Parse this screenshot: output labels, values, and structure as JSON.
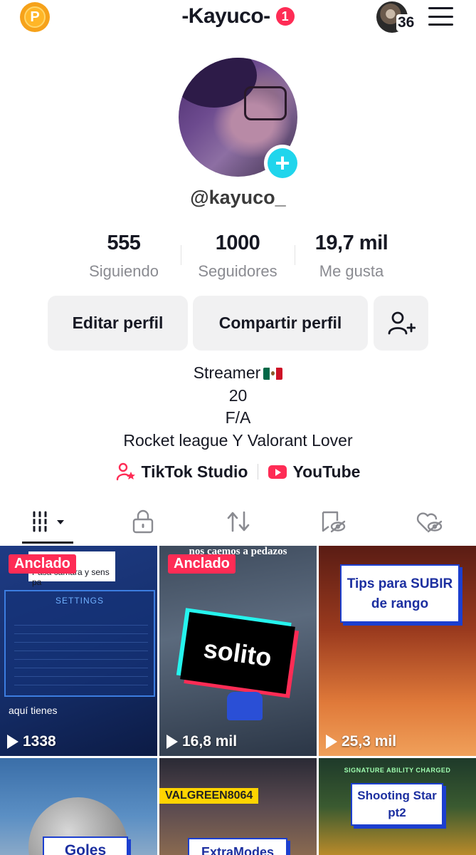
{
  "header": {
    "coin_glyph": "P",
    "title": "-Kayuco-",
    "notification_count": "1",
    "account_count": "36"
  },
  "profile": {
    "username": "@kayuco_",
    "stats": [
      {
        "value": "555",
        "label": "Siguiendo"
      },
      {
        "value": "1000",
        "label": "Seguidores"
      },
      {
        "value": "19,7 mil",
        "label": "Me gusta"
      }
    ],
    "buttons": {
      "edit": "Editar perfil",
      "share": "Compartir perfil"
    },
    "bio": [
      "Streamer",
      "20",
      "F/A",
      "Rocket league Y Valorant Lover"
    ],
    "links": {
      "studio": "TikTok Studio",
      "youtube": "YouTube"
    }
  },
  "tabs": [
    "videos",
    "private",
    "reposts",
    "hidden",
    "liked"
  ],
  "videos": [
    {
      "pinned": "Anclado",
      "views": "1338",
      "overlay_top": "Pasa cámara y sens pa",
      "overlay_bottom": "aquí tienes",
      "panel_title": "SETTINGS"
    },
    {
      "pinned": "Anclado",
      "views": "16,8 mil",
      "overlay_top": "nos caemos a pedazos",
      "sticker": "solito"
    },
    {
      "views": "25,3 mil",
      "title_line1": "Tips para SUBIR",
      "title_line2": "de rango"
    },
    {
      "title": "Goles"
    },
    {
      "name_tag": "VALGREEN8064",
      "title": "ExtraModes"
    },
    {
      "banner": "SIGNATURE ABILITY CHARGED",
      "title_line1": "Shooting Star",
      "title_line2": "pt2"
    }
  ],
  "colors": {
    "accent_red": "#fe2c55",
    "accent_cyan": "#20d5ec",
    "text": "#161823",
    "muted": "#8a8b91"
  }
}
